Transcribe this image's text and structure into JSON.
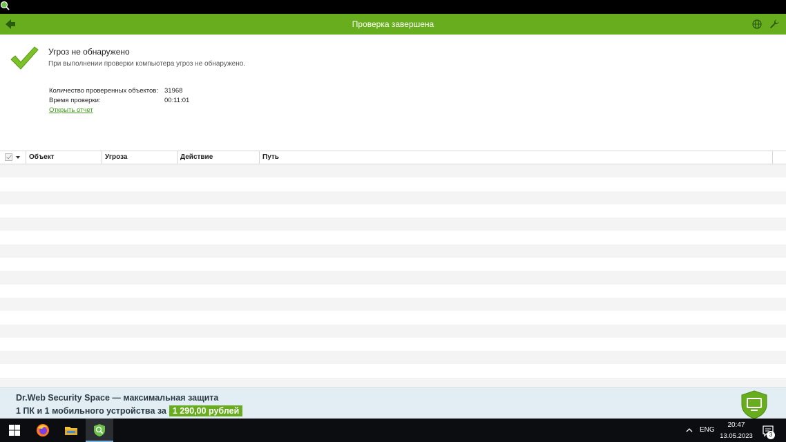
{
  "window": {
    "title": "Проверка завершена"
  },
  "result": {
    "title": "Угроз не обнаружено",
    "subtitle": "При выполнении проверки компьютера угроз не обнаружено.",
    "stats": [
      {
        "label": "Количество проверенных объектов:",
        "value": "31968"
      },
      {
        "label": "Время проверки:",
        "value": "00:11:01"
      }
    ],
    "report_link": "Открыть отчет"
  },
  "table": {
    "columns": [
      "Объект",
      "Угроза",
      "Действие",
      "Путь"
    ],
    "rows": []
  },
  "banner": {
    "line1": "Dr.Web Security Space — максимальная защита",
    "line2": "1 ПК и 1 мобильного устройства за",
    "price": "1 290,00 рублей"
  },
  "taskbar": {
    "language": "ENG",
    "time": "20:47",
    "date": "13.05.2023",
    "notification_count": "3"
  },
  "colors": {
    "accent": "#68ad1e",
    "link": "#3f9a1b",
    "banner_bg": "#e3eef4",
    "taskbar_bg": "#0b0d10"
  },
  "icons": [
    "drweb-app-icon",
    "back-arrow-icon",
    "globe-icon",
    "wrench-icon",
    "checkmark-icon",
    "shield-monitor-icon",
    "windows-start-icon",
    "firefox-icon",
    "file-explorer-icon",
    "drweb-scanner-icon",
    "chevron-up-icon",
    "notification-icon"
  ]
}
